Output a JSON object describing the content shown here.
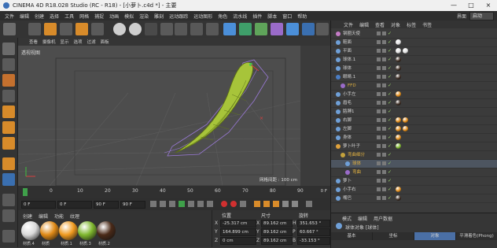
{
  "app": {
    "title": "CINEMA 4D R18.028 Studio (RC - R18) - [小萝卜.c4d *] - 主要",
    "window_buttons": [
      "—",
      "□",
      "×"
    ]
  },
  "menubar": {
    "items": [
      "文件",
      "编辑",
      "创建",
      "选择",
      "工具",
      "网格",
      "捕捉",
      "动画",
      "模拟",
      "渲染",
      "雕刻",
      "运动跟踪",
      "运动图形",
      "角色",
      "流水线",
      "插件",
      "脚本",
      "窗口",
      "帮助"
    ],
    "layout_label": "界面",
    "layout_value": "启动"
  },
  "viewport": {
    "menu": [
      "查看",
      "摄像机",
      "显示",
      "选项",
      "过滤",
      "面板"
    ],
    "label": "透视视图",
    "grid_info": "网格间距 : 100 cm"
  },
  "timeline": {
    "ticks": [
      "0",
      "10",
      "20",
      "30",
      "40",
      "50",
      "60",
      "70",
      "80",
      "90"
    ],
    "end_frame_label": "0 F"
  },
  "transport": {
    "start_field": "0 F",
    "current_field": "0 F",
    "end_field": "90 F",
    "end_field2": "90 F"
  },
  "materials": {
    "menu": [
      "创建",
      "编辑",
      "功能",
      "纹理"
    ],
    "items": [
      {
        "label": "材质.4",
        "color": "#d9d9d9"
      },
      {
        "label": "材质",
        "color": "#e08a17"
      },
      {
        "label": "材质.1",
        "color": "#f09a1f"
      },
      {
        "label": "材质.3",
        "color": "#7fb72e"
      },
      {
        "label": "材质.2",
        "color": "#4a2a18"
      }
    ]
  },
  "coordinates": {
    "headers": [
      "位置",
      "尺寸",
      "旋转"
    ],
    "rows": [
      {
        "axis": "X",
        "pos": "-25.317 cm",
        "size": "89.162 cm",
        "rot_axis": "H",
        "rot": "351.653 °"
      },
      {
        "axis": "Y",
        "pos": "164.899 cm",
        "size": "89.162 cm",
        "rot_axis": "P",
        "rot": "60.667 °"
      },
      {
        "axis": "Z",
        "pos": "0 cm",
        "size": "89.162 cm",
        "rot_axis": "B",
        "rot": "-33.153 °"
      }
    ]
  },
  "objects": {
    "menu": [
      "文件",
      "编辑",
      "查看",
      "对象",
      "标签",
      "书签"
    ],
    "rows": [
      {
        "name": "钢圈天使",
        "indent": 0,
        "icon": "#c57cc7",
        "tags": []
      },
      {
        "name": "鞋面",
        "indent": 0,
        "icon": "#6fa0d8",
        "tags": [
          "#e2e2e2"
        ]
      },
      {
        "name": "平面",
        "indent": 0,
        "icon": "#6fa0d8",
        "tags": [
          "#e2e2e2",
          "#e2e2e2"
        ]
      },
      {
        "name": "球体.1",
        "indent": 0,
        "icon": "#6fa0d8",
        "tags": [
          "#3a2a20"
        ]
      },
      {
        "name": "球体",
        "indent": 0,
        "icon": "#6fa0d8",
        "tags": [
          "#3a2a20"
        ]
      },
      {
        "name": "眼睛.1",
        "indent": 0,
        "icon": "#4a7dc4",
        "tags": [
          "#3a2a20"
        ]
      },
      {
        "name": "FFD",
        "indent": 1,
        "icon": "#9a6bc9",
        "tags": []
      },
      {
        "name": "小手左",
        "indent": 0,
        "icon": "#6fa0d8",
        "tags": [
          "#e08a17"
        ]
      },
      {
        "name": "眉毛",
        "indent": 0,
        "icon": "#6fa0d8",
        "tags": [
          "#3a2a20"
        ]
      },
      {
        "name": "胳膊1",
        "indent": 0,
        "icon": "#6fa0d8",
        "tags": []
      },
      {
        "name": "右脚",
        "indent": 0,
        "icon": "#6fa0d8",
        "tags": [
          "#e08a17",
          "#e08a17"
        ]
      },
      {
        "name": "左脚",
        "indent": 0,
        "icon": "#6fa0d8",
        "tags": [
          "#e08a17",
          "#e08a17"
        ]
      },
      {
        "name": "身体",
        "indent": 0,
        "icon": "#6fa0d8",
        "tags": [
          "#e08a17"
        ]
      },
      {
        "name": "萝卜叶子",
        "indent": 0,
        "icon": "#e0a23c",
        "tags": [
          "#7fb72e"
        ]
      },
      {
        "name": "弯曲细分",
        "indent": 1,
        "icon": "#c4a23c",
        "tags": []
      },
      {
        "name": "球体",
        "indent": 2,
        "icon": "#6fa0d8",
        "tags": []
      },
      {
        "name": "弯曲",
        "indent": 2,
        "icon": "#9a6bc9",
        "tags": []
      },
      {
        "name": "萝卜",
        "indent": 0,
        "icon": "#6fa0d8",
        "tags": []
      },
      {
        "name": "小手右",
        "indent": 0,
        "icon": "#6fa0d8",
        "tags": [
          "#e08a17"
        ]
      },
      {
        "name": "嘴巴",
        "indent": 0,
        "icon": "#6fa0d8",
        "tags": [
          "#3a2a20"
        ]
      }
    ]
  },
  "attributes": {
    "menu": [
      "模式",
      "编辑",
      "用户数据"
    ],
    "object_label": "球体对象 [球体]",
    "tabs": [
      "基本",
      "坐标",
      "对象",
      "平滑着色(Phong)"
    ],
    "active_tab": "对象"
  }
}
